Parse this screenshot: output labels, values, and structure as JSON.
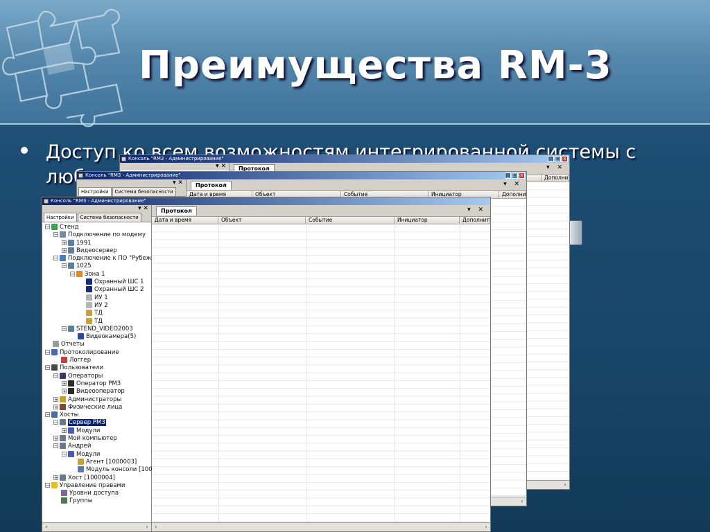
{
  "slide": {
    "title": "Преимущества RM-3",
    "bullet": "Доступ ко всем возможностям интегрированной системы с любого терминала"
  },
  "window": {
    "title": "Консоль \"RM3 - Администрирование\"",
    "panel_controls": "▾ ✕",
    "buttons": {
      "minimize": "_",
      "maximize": "□",
      "close": "x"
    },
    "side_tabs": [
      "Настройки",
      "Система безопасности"
    ],
    "main_tab": "Протокол",
    "main_controls": "▾ ✕",
    "columns": [
      "Дата и время",
      "Объект",
      "Событие",
      "Инициатор",
      "Дополнит"
    ]
  },
  "tree": [
    {
      "label": "Стенд",
      "toggle": "⊟",
      "icon": "globe-icon",
      "color": "#3aa35a"
    },
    {
      "label": "Подключение по модему",
      "toggle": "⊟",
      "icon": "modem-icon",
      "color": "#7a8a9a"
    },
    {
      "label": "1991",
      "toggle": "⊞",
      "icon": "device-icon",
      "color": "#5f7fa0"
    },
    {
      "label": "Видеосервер",
      "toggle": "⊞",
      "icon": "device-icon",
      "color": "#5f7fa0"
    },
    {
      "label": "Подключение к ПО \"Рубеж",
      "toggle": "⊟",
      "icon": "monitor-icon",
      "color": "#4a7ac0"
    },
    {
      "label": "1025",
      "toggle": "⊟",
      "icon": "device-icon",
      "color": "#5f7fa0"
    },
    {
      "label": "Зона 1",
      "toggle": "⊟",
      "icon": "zone-icon",
      "color": "#e08a2a"
    },
    {
      "label": "Охранный ШС 1",
      "toggle": "",
      "icon": "sensor-icon",
      "color": "#1a2a7a"
    },
    {
      "label": "Охранный ШС 2",
      "toggle": "",
      "icon": "sensor-icon",
      "color": "#1a2a7a"
    },
    {
      "label": "ИУ 1",
      "toggle": "",
      "icon": "actuator-icon",
      "color": "#b5b5b5"
    },
    {
      "label": "ИУ 2",
      "toggle": "",
      "icon": "actuator-icon",
      "color": "#b5b5b5"
    },
    {
      "label": "ТД",
      "toggle": "",
      "icon": "door-icon",
      "color": "#c8a040"
    },
    {
      "label": "ТД",
      "toggle": "",
      "icon": "door-icon",
      "color": "#c8a040"
    },
    {
      "label": "STEND_VIDEO2003",
      "toggle": "⊟",
      "icon": "server-icon",
      "color": "#5f7fa0"
    },
    {
      "label": "Видеокамера(5)",
      "toggle": "",
      "icon": "camera-icon",
      "color": "#2a4aa0"
    },
    {
      "label": "Отчеты",
      "toggle": "",
      "icon": "report-icon",
      "color": "#9a9a9a"
    },
    {
      "label": "Протоколирование",
      "toggle": "⊟",
      "icon": "log-icon",
      "color": "#4a6ab0"
    },
    {
      "label": "Логгер",
      "toggle": "",
      "icon": "logger-icon",
      "color": "#c04040"
    },
    {
      "label": "Пользователи",
      "toggle": "⊟",
      "icon": "users-icon",
      "color": "#4a4a4a"
    },
    {
      "label": "Операторы",
      "toggle": "⊟",
      "icon": "operators-icon",
      "color": "#3a3a6a"
    },
    {
      "label": "Оператор РМ3",
      "toggle": "⊞",
      "icon": "user-icon",
      "color": "#2a2a2a"
    },
    {
      "label": "Видеооператор",
      "toggle": "⊞",
      "icon": "user-icon",
      "color": "#2a2a2a"
    },
    {
      "label": "Администраторы",
      "toggle": "⊞",
      "icon": "admins-icon",
      "color": "#c0a030"
    },
    {
      "label": "Физические лица",
      "toggle": "⊞",
      "icon": "persons-icon",
      "color": "#7a4a3a"
    },
    {
      "label": "Хосты",
      "toggle": "⊟",
      "icon": "hosts-icon",
      "color": "#4a6aa0"
    },
    {
      "label": "Сервер РМ3",
      "toggle": "⊟",
      "icon": "server-icon",
      "color": "#6a7a8a",
      "selected": true
    },
    {
      "label": "Модули",
      "toggle": "⊞",
      "icon": "modules-icon",
      "color": "#4a5ab0"
    },
    {
      "label": "Мой компьютер",
      "toggle": "⊞",
      "icon": "computer-icon",
      "color": "#6a7a8a"
    },
    {
      "label": "Андрей",
      "toggle": "⊟",
      "icon": "computer-icon",
      "color": "#6a7a8a"
    },
    {
      "label": "Модули",
      "toggle": "⊟",
      "icon": "modules-icon",
      "color": "#4a5ab0"
    },
    {
      "label": "Агент [1000003]",
      "toggle": "",
      "icon": "agent-icon",
      "color": "#c0a040"
    },
    {
      "label": "Модуль консоли [1000",
      "toggle": "",
      "icon": "console-module-icon",
      "color": "#5a7ab0"
    },
    {
      "label": "Хост [1000004]",
      "toggle": "⊞",
      "icon": "computer-icon",
      "color": "#6a7a8a"
    },
    {
      "label": "Управление правами",
      "toggle": "⊟",
      "icon": "rights-icon",
      "color": "#e0c030"
    },
    {
      "label": "Уровни доступа",
      "toggle": "",
      "icon": "access-levels-icon",
      "color": "#7a6a9a"
    },
    {
      "label": "Группы",
      "toggle": "",
      "icon": "groups-icon",
      "color": "#4a7a5a"
    }
  ]
}
